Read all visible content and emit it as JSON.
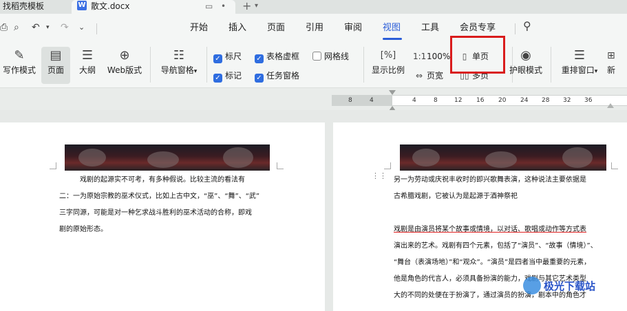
{
  "tabs": {
    "inactive_label": "找稻壳模板",
    "active_label": "散文.docx",
    "active_logo": "W",
    "new_tab": "+"
  },
  "menu": {
    "items": [
      "开始",
      "插入",
      "页面",
      "引用",
      "审阅",
      "视图",
      "工具",
      "会员专享"
    ],
    "active": "视图"
  },
  "ribbon": {
    "write_mode": "写作模式",
    "page": "页面",
    "outline": "大纲",
    "web_layout": "Web版式",
    "nav_pane": "导航窗格",
    "ruler": "标尺",
    "table_gridlines": "表格虚框",
    "gridlines": "网格线",
    "markup": "标记",
    "task_pane": "任务窗格",
    "zoom": "显示比例",
    "zoom_100": "100%",
    "page_width": "页宽",
    "single_page": "单页",
    "multi_page": "多页",
    "eye_protect": "护眼模式",
    "rearrange": "重排窗口",
    "new_window_partial": "新"
  },
  "checkboxes": {
    "ruler": true,
    "table_gridlines": true,
    "gridlines": false,
    "markup": true,
    "task_pane": true
  },
  "ruler_ticks": [
    "8",
    "4",
    "4",
    "8",
    "12",
    "16",
    "20",
    "24",
    "28",
    "32",
    "36"
  ],
  "left_page": {
    "lines": [
      "戏剧的起源实不可考，有多种假说。比较主流的看法有",
      "二：一为原始宗教的巫术仪式，比如上古中文，“巫”、“舞”、“武”",
      "三字同源，可能是对一种乞求战斗胜利的巫术活动的合称，即戏",
      "剧的原始形态。"
    ]
  },
  "right_page": {
    "lines": [
      "另一为劳动或庆祝丰收时的即兴歌舞表演，这种说法主要依据是",
      "古希腊戏剧，它被认为是起源于酒神祭祀",
      "戏剧是由演员将某个故事或情境，以对话、歌唱或动作等方式表",
      "演出来的艺术。戏剧有四个元素，包括了“演员”、“故事（情境）”、",
      "“舞台（表演场地）”和“观众”。“演员”是四者当中最重要的元素，",
      "他是角色的代言人，必须具备扮演的能力，戏剧与其它艺术类型",
      "大的不同的处便在于扮演了，通过演员的扮演，剧本中的角色才"
    ]
  },
  "watermark": "极光下载站",
  "colors": {
    "accent": "#2b5dd8",
    "checkbox": "#2f6de0",
    "highlight_box": "#d91c1c",
    "link": "#1a3bd1"
  }
}
